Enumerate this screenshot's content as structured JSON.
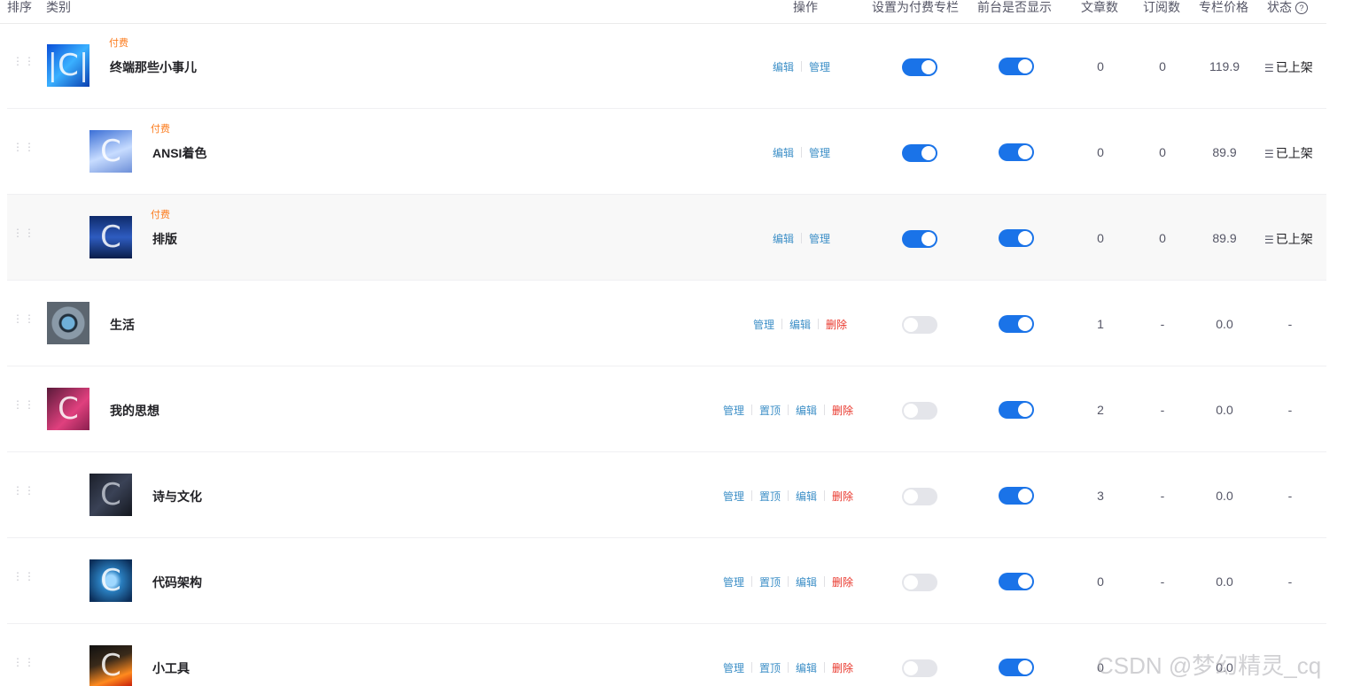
{
  "columns": {
    "sort": "排序",
    "category": "类别",
    "actions": "操作",
    "set_paid": "设置为付费专栏",
    "frontend_show": "前台是否显示",
    "article_count": "文章数",
    "subscribe_count": "订阅数",
    "price": "专栏价格",
    "status": "状态"
  },
  "action_labels": {
    "manage": "管理",
    "edit": "编辑",
    "pin": "置顶",
    "delete": "删除"
  },
  "rows": [
    {
      "name": "终端那些小事儿",
      "tag": "付费",
      "articles": "0",
      "subs": "0",
      "price": "119.9",
      "status": "已上架",
      "paid_on": true,
      "show_on": true
    },
    {
      "name": "ANSI着色",
      "tag": "付费",
      "articles": "0",
      "subs": "0",
      "price": "89.9",
      "status": "已上架",
      "paid_on": true,
      "show_on": true
    },
    {
      "name": "排版",
      "tag": "付费",
      "articles": "0",
      "subs": "0",
      "price": "89.9",
      "status": "已上架",
      "paid_on": true,
      "show_on": true
    },
    {
      "name": "生活",
      "tag": "",
      "articles": "1",
      "subs": "-",
      "price": "0.0",
      "status": "-",
      "paid_on": false,
      "show_on": true
    },
    {
      "name": "我的思想",
      "tag": "",
      "articles": "2",
      "subs": "-",
      "price": "0.0",
      "status": "-",
      "paid_on": false,
      "show_on": true
    },
    {
      "name": "诗与文化",
      "tag": "",
      "articles": "3",
      "subs": "-",
      "price": "0.0",
      "status": "-",
      "paid_on": false,
      "show_on": true
    },
    {
      "name": "代码架构",
      "tag": "",
      "articles": "0",
      "subs": "-",
      "price": "0.0",
      "status": "-",
      "paid_on": false,
      "show_on": true
    },
    {
      "name": "小工具",
      "tag": "",
      "articles": "0",
      "subs": "-",
      "price": "0.0",
      "status": "-",
      "paid_on": false,
      "show_on": true
    }
  ],
  "watermark": "CSDN @梦幻精灵_cq",
  "colors": {
    "accent": "#1a73e8",
    "link": "#3d8fc7",
    "danger": "#e9362b",
    "paid_tag": "#fc7d1f"
  }
}
